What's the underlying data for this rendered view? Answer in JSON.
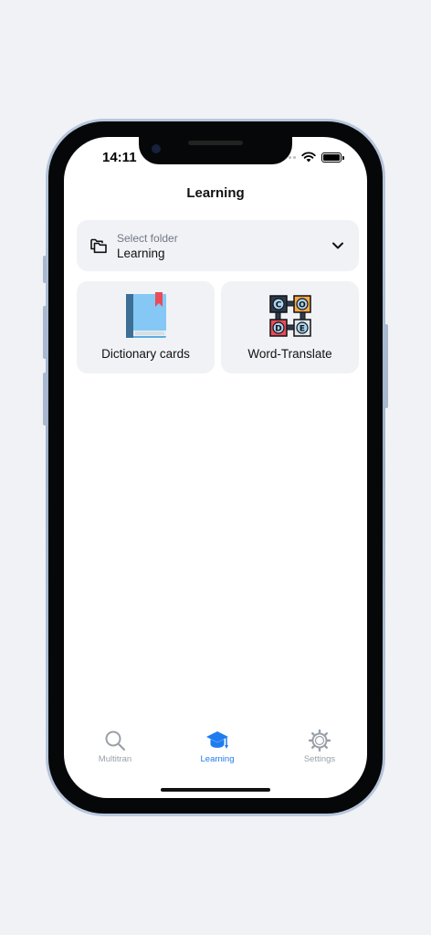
{
  "status_bar": {
    "time": "14:11"
  },
  "header": {
    "title": "Learning"
  },
  "folder_selector": {
    "label": "Select folder",
    "value": "Learning"
  },
  "cards": [
    {
      "label": "Dictionary cards",
      "icon": "book-icon"
    },
    {
      "label": "Word-Translate",
      "icon": "code-blocks-icon"
    }
  ],
  "code_icon_letters": [
    "C",
    "O",
    "D",
    "E"
  ],
  "tabbar": {
    "items": [
      {
        "label": "Multitran",
        "icon": "search-icon",
        "active": false
      },
      {
        "label": "Learning",
        "icon": "graduation-cap-icon",
        "active": true
      },
      {
        "label": "Settings",
        "icon": "gear-icon",
        "active": false
      }
    ]
  },
  "colors": {
    "accent": "#1f7cf0",
    "card_background": "#f1f2f6",
    "inactive_tab": "#9aa0a8"
  }
}
